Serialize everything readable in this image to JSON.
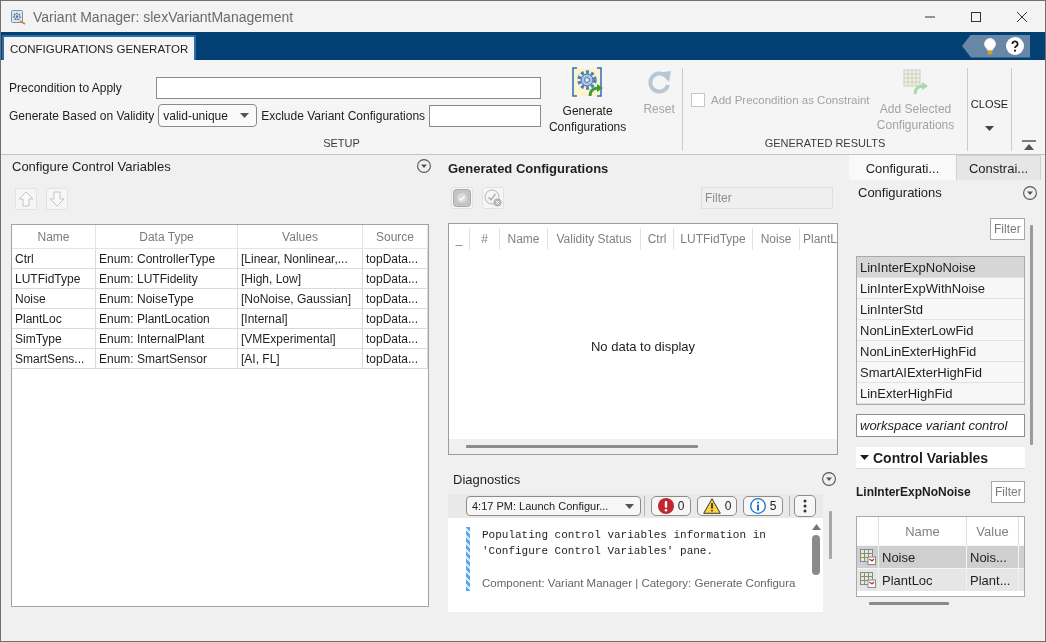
{
  "window": {
    "title": "Variant Manager: slexVariantManagement"
  },
  "toolstrip": {
    "tabs": [
      {
        "label": "CONFIGURATIONS GENERATOR",
        "selected": true
      }
    ],
    "setup": {
      "title": "SETUP",
      "precondition": {
        "label": "Precondition to Apply"
      },
      "validity": {
        "label": "Generate Based on Validity",
        "value": "valid-unique"
      },
      "exclude": {
        "label": "Exclude Variant Configurations"
      },
      "buttons": [
        {
          "kind": "generate",
          "label": "Generate Configurations",
          "disabled": false
        },
        {
          "kind": "reset",
          "label": "Reset",
          "disabled": true
        }
      ]
    },
    "generated_results": {
      "title": "GENERATED RESULTS",
      "constraint": {
        "label": "Add Precondition as Constraint",
        "checked": false,
        "disabled": true
      },
      "add_selected": {
        "label": "Add Selected Configurations",
        "disabled": true
      }
    },
    "close": {
      "label": "CLOSE"
    }
  },
  "control_variables": {
    "title": "Configure Control Variables",
    "move_buttons": [
      {
        "kind": "up",
        "disabled": true
      },
      {
        "kind": "down",
        "disabled": true
      }
    ],
    "table": {
      "columns": [
        "Name",
        "Data Type",
        "Values",
        "Source"
      ],
      "rows": [
        [
          "Ctrl",
          "Enum: ControllerType",
          "[Linear, Nonlinear,...",
          "topData..."
        ],
        [
          "LUTFidType",
          "Enum: LUTFidelity",
          "[High, Low]",
          "topData..."
        ],
        [
          "Noise",
          "Enum: NoiseType",
          "[NoNoise, Gaussian]",
          "topData..."
        ],
        [
          "PlantLoc",
          "Enum: PlantLocation",
          "[Internal]",
          "topData..."
        ],
        [
          "SimType",
          "Enum: InternalPlant",
          "[VMExperimental]",
          "topData..."
        ],
        [
          "SmartSens...",
          "Enum: SmartSensor",
          "[AI, FL]",
          "topData..."
        ]
      ]
    }
  },
  "generated_configurations": {
    "title": "Generated Configurations",
    "tools": [
      {
        "kind": "check",
        "disabled": true
      },
      {
        "kind": "uncheck",
        "disabled": true
      }
    ],
    "filter": {
      "placeholder": "Filter",
      "disabled": true
    },
    "table": {
      "columns": [
        "_",
        "#",
        "Name",
        "Validity Status",
        "Ctrl",
        "LUTFidType",
        "Noise",
        "PlantL"
      ],
      "empty_text": "No data to display"
    }
  },
  "diagnostics": {
    "title": "Diagnostics",
    "session": "4:17 PM: Launch Configur...",
    "counts": [
      {
        "kind": "error",
        "count": "0"
      },
      {
        "kind": "warning",
        "count": "0"
      },
      {
        "kind": "info",
        "count": "5"
      }
    ],
    "messages": [
      {
        "kind": "info",
        "text": "Populating control variables information in 'Configure Control Variables' pane.",
        "details": "Component: Variant Manager | Category: Generate Configura"
      }
    ]
  },
  "side_panel": {
    "tabs": [
      {
        "label": "Configurati...",
        "selected": true
      },
      {
        "label": "Constrai...",
        "selected": false
      }
    ],
    "configurations": {
      "title": "Configurations",
      "filter": {
        "placeholder": "Filter"
      },
      "items": [
        {
          "label": "LinInterExpNoNoise",
          "selected": true
        },
        {
          "label": "LinInterExpWithNoise",
          "selected": false
        },
        {
          "label": "LinInterStd",
          "selected": false
        },
        {
          "label": "NonLinExterLowFid",
          "selected": false
        },
        {
          "label": "NonLinExterHighFid",
          "selected": false
        },
        {
          "label": "SmartAIExterHighFid",
          "selected": false
        },
        {
          "label": "LinExterHighFid",
          "selected": false
        }
      ],
      "source": {
        "value": "workspace variant control"
      }
    },
    "control_variables": {
      "title": "Control Variables",
      "expanded": true,
      "configuration": "LinInterExpNoNoise",
      "filter": {
        "placeholder": "Filter"
      },
      "columns": [
        "Name",
        "Value"
      ],
      "rows": [
        {
          "name": "Noise",
          "value": "Nois...",
          "selected": true
        },
        {
          "name": "PlantLoc",
          "value": "Plant...",
          "selected": false
        }
      ]
    }
  }
}
